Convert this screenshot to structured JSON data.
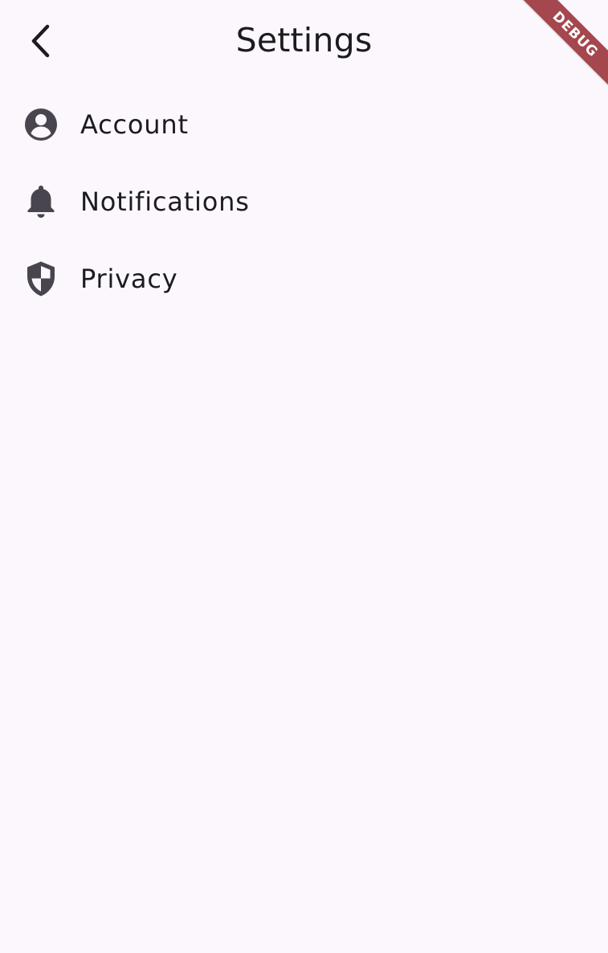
{
  "app_bar": {
    "title": "Settings",
    "back_icon": "chevron-left-icon"
  },
  "settings_items": [
    {
      "label": "Account",
      "icon": "account-circle-icon"
    },
    {
      "label": "Notifications",
      "icon": "bell-icon"
    },
    {
      "label": "Privacy",
      "icon": "shield-icon"
    }
  ],
  "debug_banner": {
    "label": "DEBUG",
    "color": "#a5474e"
  },
  "colors": {
    "background": "#fcf7fd",
    "text": "#1d1b20",
    "icon": "#49454f"
  }
}
